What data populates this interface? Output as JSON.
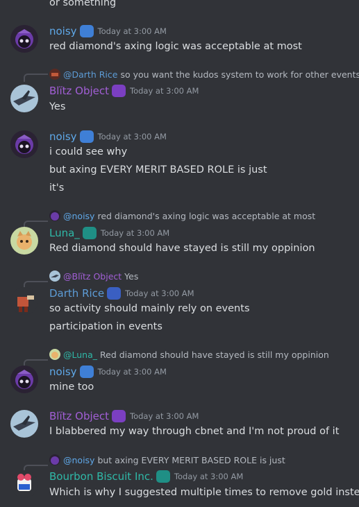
{
  "colors": {
    "background": "#313338",
    "text": "#dbdee1",
    "muted": "#949ba4",
    "noisy": "#5fa8e8",
    "blitz": "#a25fd6",
    "luna": "#2fb9a8",
    "darth": "#5d9cd6",
    "bourbon": "#2fb9a8"
  },
  "top_fragment": "or something",
  "messages": [
    {
      "author": "noisy",
      "badge_icon": "controller-icon",
      "timestamp": "Today at 3:00 AM",
      "lines": [
        "red diamond's axing logic was acceptable at most"
      ]
    },
    {
      "reply": {
        "mention": "@Darth Rice",
        "text": "so you want the kudos system to work for other events"
      },
      "author": "Blïtz Object",
      "badge_icon": "game-icon",
      "timestamp": "Today at 3:00 AM",
      "lines": [
        "Yes"
      ]
    },
    {
      "author": "noisy",
      "badge_icon": "controller-icon",
      "timestamp": "Today at 3:00 AM",
      "lines": [
        "i could see why",
        "but axing EVERY MERIT BASED ROLE is just",
        "it's"
      ]
    },
    {
      "reply": {
        "mention": "@noisy",
        "text": "red diamond's axing logic was acceptable at most"
      },
      "author": "Luna_",
      "badge_icon": "gamepad-icon",
      "timestamp": "Today at 3:00 AM",
      "lines": [
        "Red diamond should have stayed is still my oppinion"
      ]
    },
    {
      "reply": {
        "mention": "@Blïtz Object",
        "text": "Yes"
      },
      "author": "Darth Rice",
      "badge_icon": "card-icon",
      "timestamp": "Today at 3:00 AM",
      "lines": [
        "so activity should mainly rely on events",
        "participation in events"
      ]
    },
    {
      "reply": {
        "mention": "@Luna_",
        "text": "Red diamond should have stayed is still my oppinion"
      },
      "author": "noisy",
      "badge_icon": "controller-icon",
      "timestamp": "Today at 3:00 AM",
      "lines": [
        "mine too"
      ]
    },
    {
      "author": "Blïtz Object",
      "badge_icon": "game-icon",
      "timestamp": "Today at 3:00 AM",
      "lines": [
        "I blabbered my way through cbnet and I'm not proud of it"
      ]
    },
    {
      "reply": {
        "mention": "@noisy",
        "text": "but axing EVERY MERIT BASED ROLE is just"
      },
      "author": "Bourbon Biscuit Inc.",
      "badge_icon": "gamepad-icon",
      "timestamp": "Today at 3:00 AM",
      "lines": [
        "Which is why I suggested multiple times to remove gold instead"
      ]
    }
  ]
}
